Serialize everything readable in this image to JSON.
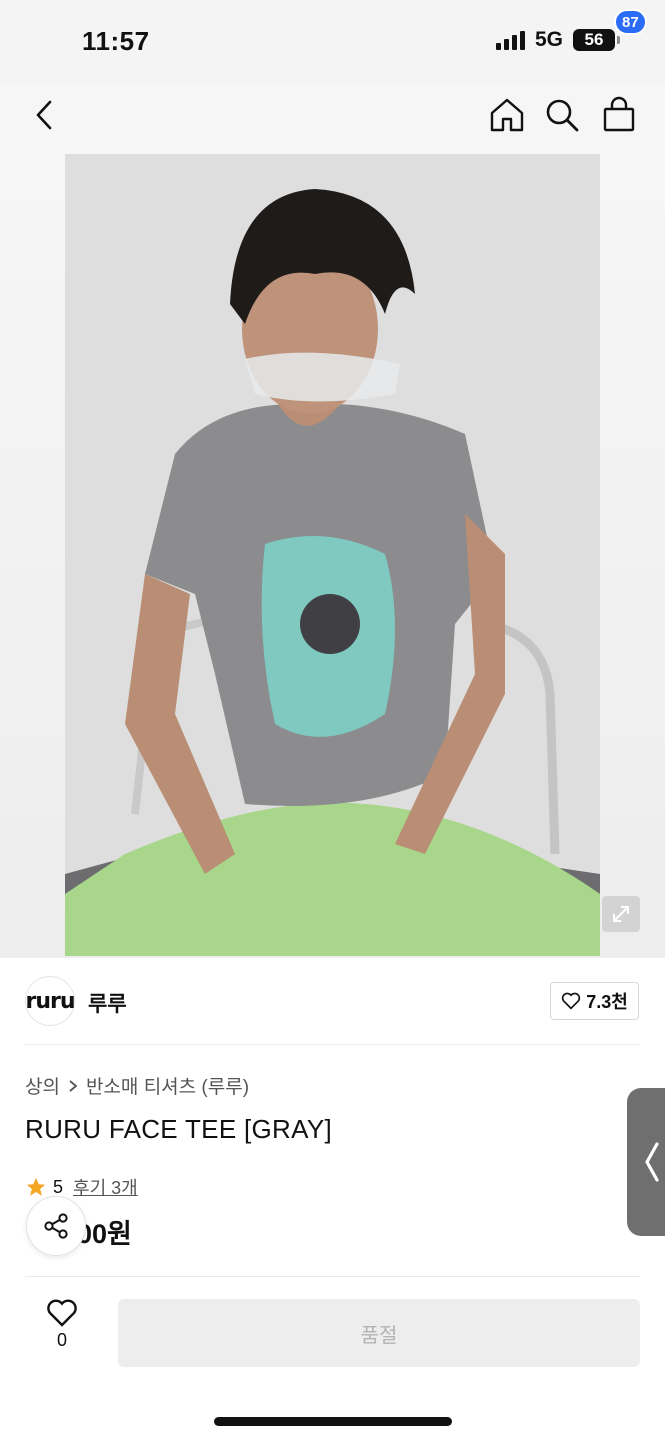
{
  "status_bar": {
    "time": "11:57",
    "network": "5G",
    "battery": "56"
  },
  "nav": {
    "cart_badge": "87",
    "icons": [
      "chevron-left-icon",
      "home-icon",
      "search-icon",
      "shopping-bag-icon"
    ]
  },
  "product_image": {
    "alt": ""
  },
  "brand": {
    "logo_text": "ruru",
    "name": "루루",
    "like_count": "7.3천"
  },
  "breadcrumb": {
    "level1": "상의",
    "level2": "반소매 티셔츠 (루루)"
  },
  "product": {
    "title": "RURU FACE TEE [GRAY]",
    "rating": "5",
    "review_link": "후기 3개",
    "price_visible": "00원"
  },
  "bottom_bar": {
    "wish_count": "0",
    "soldout_label": "품절"
  },
  "colors": {
    "accent_badge": "#2a6cf6",
    "star": "#f5a623",
    "soldout_bg": "#ededed"
  }
}
